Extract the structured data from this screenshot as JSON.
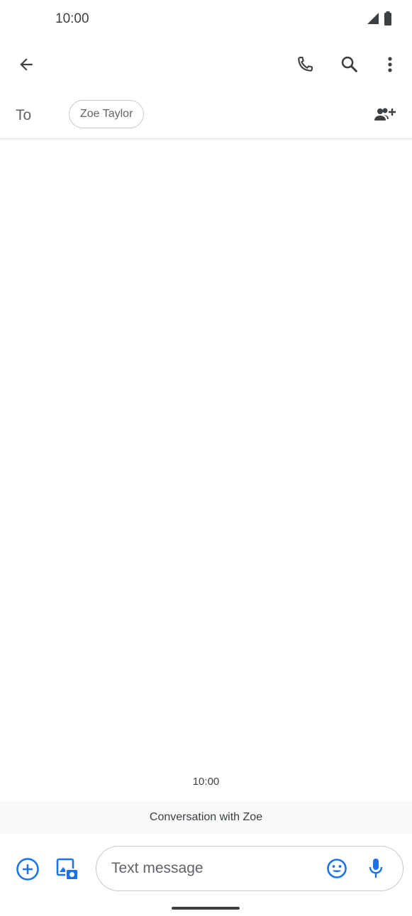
{
  "status_bar": {
    "time": "10:00",
    "icons": [
      "signal-icon",
      "battery-icon"
    ]
  },
  "app_bar": {
    "icons": [
      "back-arrow-icon",
      "phone-icon",
      "search-icon",
      "more-vert-icon"
    ]
  },
  "recipients": {
    "to_label": "To",
    "chips": [
      "Zoe Taylor"
    ],
    "add_icon": "add-person-icon"
  },
  "conversation": {
    "timestamp": "10:00",
    "banner": "Conversation with Zoe"
  },
  "compose": {
    "placeholder": "Text message",
    "left_icons": [
      "add-circle-icon",
      "gallery-icon"
    ],
    "right_icons": [
      "emoji-icon",
      "mic-icon"
    ]
  },
  "colors": {
    "accent": "#1a73e8",
    "icon": "#3c4043",
    "text_secondary": "#5f6368"
  }
}
